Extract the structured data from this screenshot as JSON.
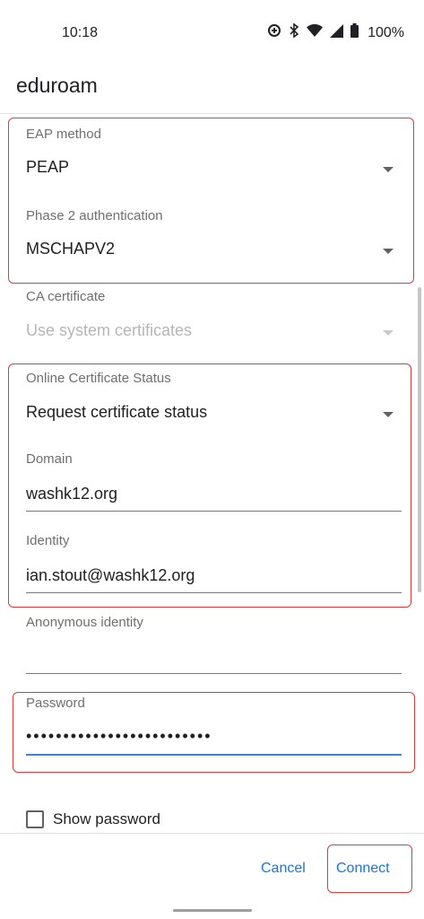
{
  "status_bar": {
    "time": "10:18",
    "battery": "100%",
    "icons": [
      "data-saver-icon",
      "bluetooth-icon",
      "wifi-icon",
      "signal-icon",
      "battery-icon"
    ]
  },
  "title": "eduroam",
  "fields": {
    "eap_method": {
      "label": "EAP method",
      "value": "PEAP"
    },
    "phase2": {
      "label": "Phase 2 authentication",
      "value": "MSCHAPV2"
    },
    "ca_certificate": {
      "label": "CA certificate",
      "value": "Use system certificates"
    },
    "ocsp": {
      "label": "Online Certificate Status",
      "value": "Request certificate status"
    },
    "domain": {
      "label": "Domain",
      "value": "washk12.org"
    },
    "identity": {
      "label": "Identity",
      "value": "ian.stout@washk12.org"
    },
    "anonymous_identity": {
      "label": "Anonymous identity",
      "value": ""
    },
    "password": {
      "label": "Password",
      "value": "•••••••••••••••••••••••••"
    }
  },
  "show_password": {
    "label": "Show password",
    "checked": false
  },
  "buttons": {
    "cancel": "Cancel",
    "connect": "Connect"
  },
  "colors": {
    "accent": "#1a73e8",
    "focus_underline": "#3f7ee3",
    "highlight": "#e53935"
  }
}
